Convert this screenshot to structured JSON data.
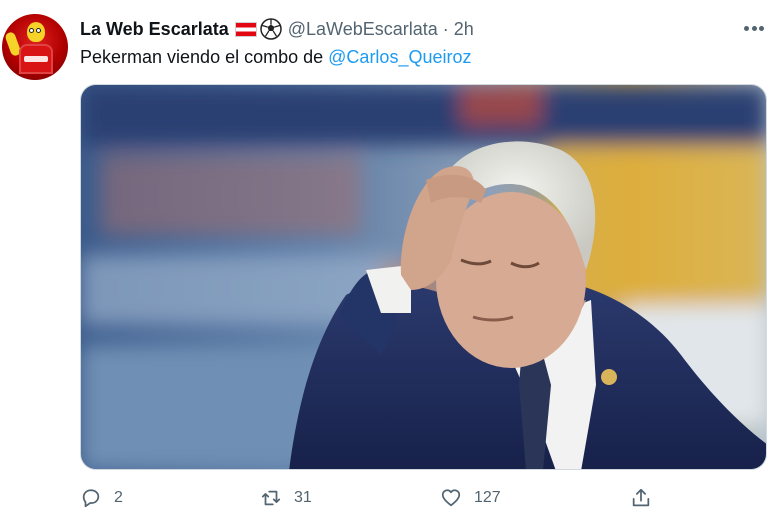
{
  "tweet": {
    "display_name": "La Web Escarlata",
    "name_emojis": [
      "austria-flag-icon",
      "soccer-ball-icon"
    ],
    "handle": "@LaWebEscarlata",
    "separator": "·",
    "time": "2h",
    "text_prefix": "Pekerman viendo el combo de ",
    "mention": "@Carlos_Queiroz",
    "media_description_icon": "photo",
    "actions": {
      "reply_count": "2",
      "retweet_count": "31",
      "like_count": "127",
      "share_icon": "share-icon"
    }
  },
  "colors": {
    "accent": "#1d9bf0",
    "secondary_text": "#536471",
    "primary_text": "#0f1419"
  }
}
